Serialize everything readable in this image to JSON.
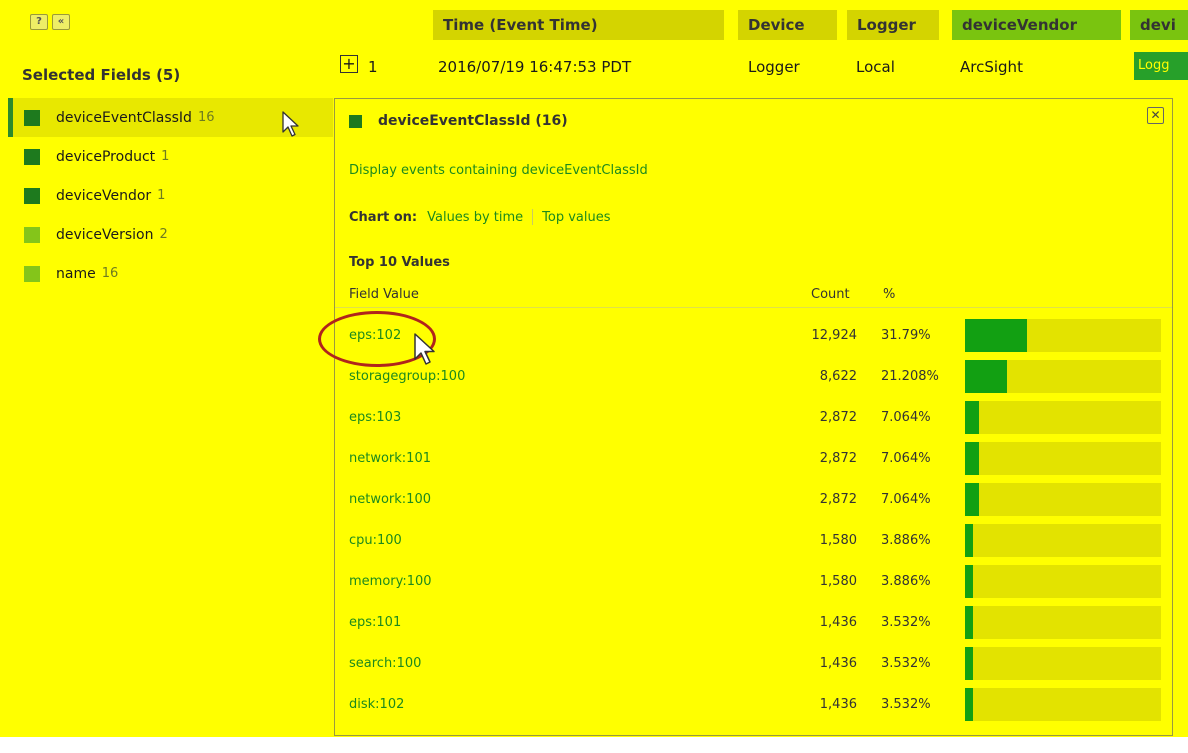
{
  "controls": {
    "help_label": "?",
    "collapse_label": "«"
  },
  "selected_fields": {
    "title": "Selected Fields (5)",
    "items": [
      {
        "name": "deviceEventClassId",
        "count": "16",
        "color": "#1e7a1e",
        "active": true
      },
      {
        "name": "deviceProduct",
        "count": "1",
        "color": "#1e7a1e"
      },
      {
        "name": "deviceVendor",
        "count": "1",
        "color": "#1e7a1e"
      },
      {
        "name": "deviceVersion",
        "count": "2",
        "color": "#84c51a"
      },
      {
        "name": "name",
        "count": "16",
        "color": "#84c51a"
      }
    ]
  },
  "table": {
    "headers": [
      {
        "label": "Time (Event Time)",
        "bg": "#d4d400"
      },
      {
        "label": "Device",
        "bg": "#d4d400"
      },
      {
        "label": "Logger",
        "bg": "#d4d400"
      },
      {
        "label": "deviceVendor",
        "bg": "#7ac40f"
      },
      {
        "label": "devi",
        "bg": "#7ac40f"
      }
    ],
    "row": {
      "index": "1",
      "time": "2016/07/19 16:47:53 PDT",
      "device": "Logger",
      "logger": "Local",
      "vendor": "ArcSight",
      "product_truncated": "Logg"
    }
  },
  "popup": {
    "title": "deviceEventClassId (16)",
    "display_link": "Display events containing deviceEventClassId",
    "chart_on_label": "Chart on:",
    "chart_links": [
      "Values by time",
      "Top values"
    ],
    "top_values_title": "Top 10 Values",
    "col_field_value": "Field Value",
    "col_count": "Count",
    "col_percent": "%",
    "close_icon": "close-icon",
    "values": [
      {
        "value": "eps:102",
        "count": "12,924",
        "percent": "31.79%",
        "fraction": 0.3179
      },
      {
        "value": "storagegroup:100",
        "count": "8,622",
        "percent": "21.208%",
        "fraction": 0.21208
      },
      {
        "value": "eps:103",
        "count": "2,872",
        "percent": "7.064%",
        "fraction": 0.07064
      },
      {
        "value": "network:101",
        "count": "2,872",
        "percent": "7.064%",
        "fraction": 0.07064
      },
      {
        "value": "network:100",
        "count": "2,872",
        "percent": "7.064%",
        "fraction": 0.07064
      },
      {
        "value": "cpu:100",
        "count": "1,580",
        "percent": "3.886%",
        "fraction": 0.03886
      },
      {
        "value": "memory:100",
        "count": "1,580",
        "percent": "3.886%",
        "fraction": 0.03886
      },
      {
        "value": "eps:101",
        "count": "1,436",
        "percent": "3.532%",
        "fraction": 0.03532
      },
      {
        "value": "search:100",
        "count": "1,436",
        "percent": "3.532%",
        "fraction": 0.03532
      },
      {
        "value": "disk:102",
        "count": "1,436",
        "percent": "3.532%",
        "fraction": 0.03532
      }
    ]
  },
  "colors": {
    "bar_fill": "#12a012",
    "bar_track": "#e3e300",
    "annotation": "#b0241c",
    "link": "#1d8a1d"
  }
}
